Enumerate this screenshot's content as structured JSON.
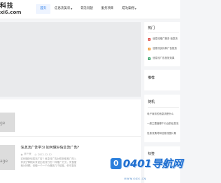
{
  "header": {
    "logo_cn": "科技",
    "logo_en": "xi6.com",
    "nav": [
      {
        "label": "首页",
        "active": true,
        "dropdown": false
      },
      {
        "label": "信息流美讯",
        "active": false,
        "dropdown": true
      },
      {
        "label": "常见问题",
        "active": false,
        "dropdown": false
      },
      {
        "label": "服务项目",
        "active": false,
        "dropdown": false
      },
      {
        "label": "成功案例",
        "active": false,
        "dropdown": true
      }
    ]
  },
  "main": {
    "thumb1_text": "ge",
    "thumb2_text": "age",
    "post": {
      "title": "信息流广告学习 如何做好信息流广告？",
      "author": "陈千夜",
      "date": "2022-12-12",
      "excerpt": [
        "如何做好信息流广告？信息流广告对很多做推广的人",
        "来说了解相对来说比较流行的一种推广方式，来做搜",
        "索对好看，但做一个一个价格放几个链接，你可能在"
      ]
    }
  },
  "sidebar": {
    "hot_title": "热门",
    "hot_items": [
      {
        "num": "1",
        "text": "信息流推广服务 信息流",
        "color": "#e0574f"
      },
      {
        "num": "2",
        "text": "信息流优化和广告投放",
        "color": "#f39b33"
      },
      {
        "num": "3",
        "text": "信息流广告投放效果",
        "color": "#3ca56b"
      }
    ],
    "recommend_title": "推荐",
    "random_title": "随机",
    "random_items": [
      "电子商务的信息流是什么",
      "一般主要做哪个行业的信息流",
      "信息流素材和信息流图片素"
    ],
    "tags_title": "标签"
  },
  "watermark": {
    "icon": "0",
    "text": "0401导航网",
    "sub": "WWW.0401.CN"
  }
}
